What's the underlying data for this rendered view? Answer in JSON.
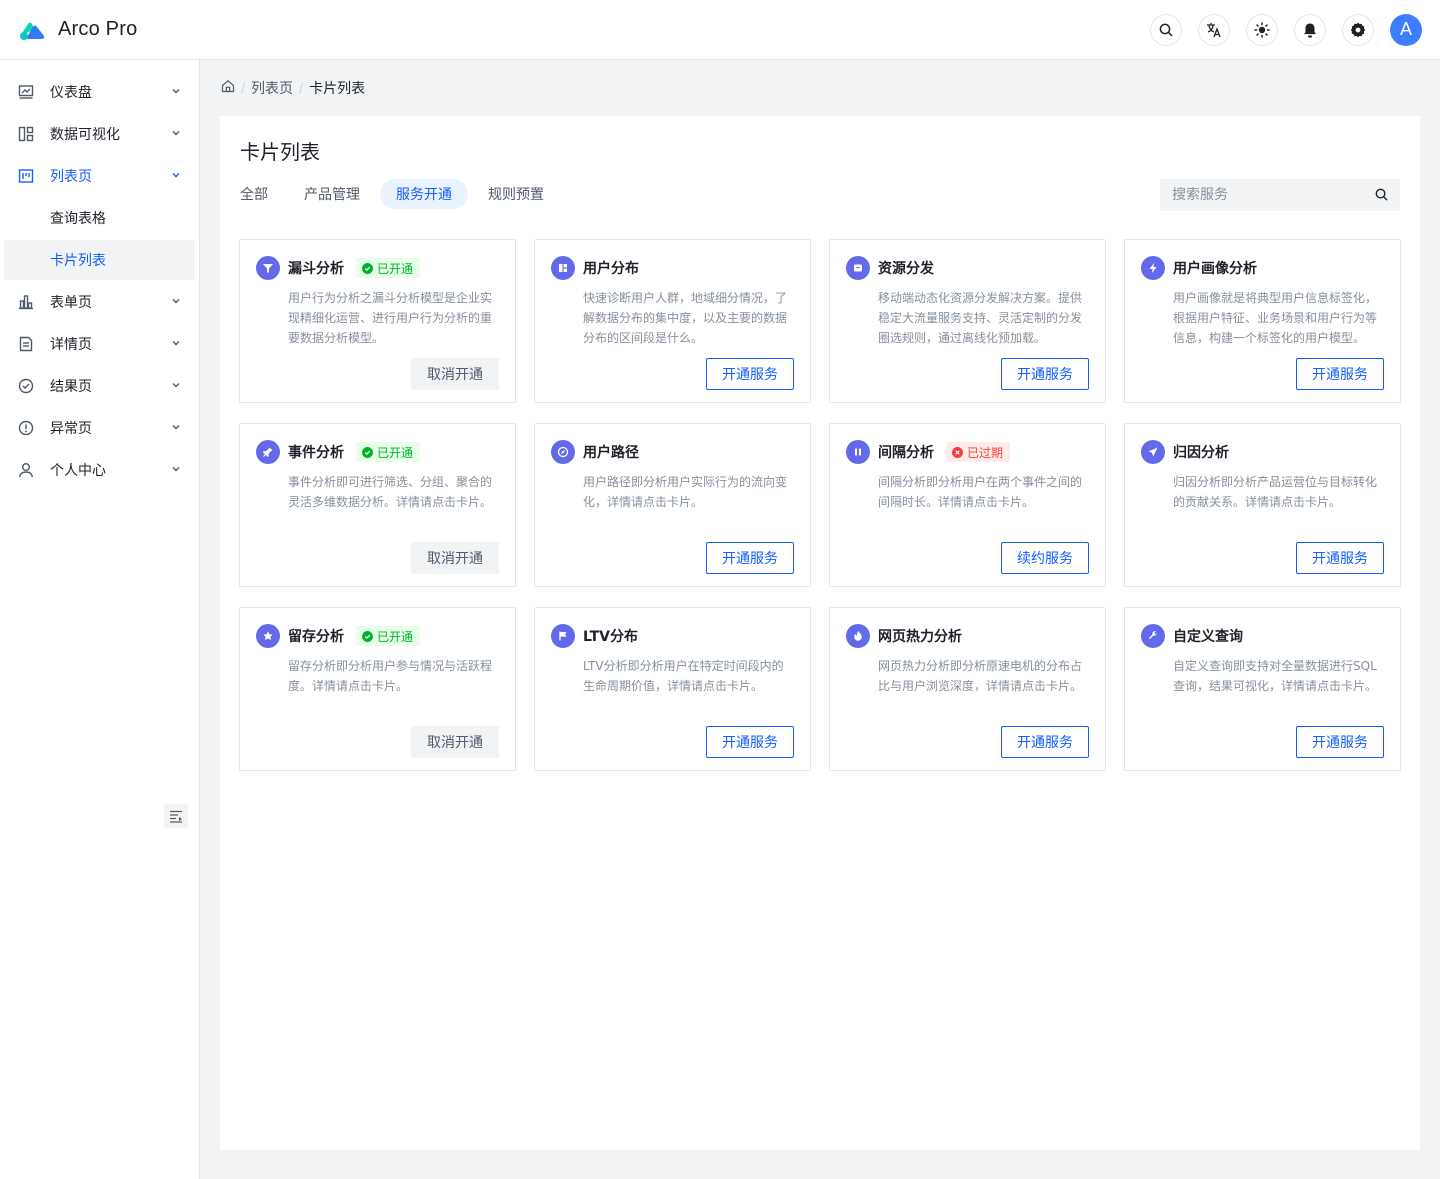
{
  "app": {
    "name": "Arco Pro"
  },
  "header": {
    "icons": [
      "search-icon",
      "translate-icon",
      "sun-icon",
      "bell-icon",
      "gear-icon"
    ],
    "avatar_initial": "A",
    "avatar_color": "#3c7eff"
  },
  "sidebar": {
    "items": [
      {
        "label": "仪表盘",
        "icon": "dashboard-icon"
      },
      {
        "label": "数据可视化",
        "icon": "layout-icon"
      },
      {
        "label": "列表页",
        "icon": "list-icon",
        "open": true,
        "children": [
          {
            "label": "查询表格"
          },
          {
            "label": "卡片列表",
            "active": true
          }
        ]
      },
      {
        "label": "表单页",
        "icon": "bar-chart-icon"
      },
      {
        "label": "详情页",
        "icon": "document-icon"
      },
      {
        "label": "结果页",
        "icon": "check-circle-icon"
      },
      {
        "label": "异常页",
        "icon": "exclamation-circle-icon"
      },
      {
        "label": "个人中心",
        "icon": "user-icon"
      }
    ]
  },
  "breadcrumb": {
    "items": [
      "列表页",
      "卡片列表"
    ]
  },
  "page": {
    "title": "卡片列表",
    "tabs": [
      {
        "label": "全部"
      },
      {
        "label": "产品管理"
      },
      {
        "label": "服务开通",
        "active": true
      },
      {
        "label": "规则预置"
      }
    ],
    "search_placeholder": "搜索服务"
  },
  "colors": {
    "primary": "#165dff",
    "success": "#00b42a",
    "danger": "#f53f3f",
    "card_icon": "#626aea"
  },
  "cards": [
    {
      "title": "漏斗分析",
      "icon": "funnel-icon",
      "tag": "已开通",
      "tag_type": "ok",
      "desc": "用户行为分析之漏斗分析模型是企业实现精细化运营、进行用户行为分析的重要数据分析模型。",
      "button": "取消开通",
      "button_type": "secondary"
    },
    {
      "title": "用户分布",
      "icon": "apps-icon",
      "tag": "",
      "tag_type": "",
      "desc": "快速诊断用户人群，地域细分情况，了解数据分布的集中度，以及主要的数据分布的区间段是什么。",
      "button": "开通服务",
      "button_type": "primary"
    },
    {
      "title": "资源分发",
      "icon": "archive-icon",
      "tag": "",
      "tag_type": "",
      "desc": "移动端动态化资源分发解决方案。提供稳定大流量服务支持、灵活定制的分发圈选规则，通过离线化预加载。",
      "button": "开通服务",
      "button_type": "primary"
    },
    {
      "title": "用户画像分析",
      "icon": "thunder-icon",
      "tag": "",
      "tag_type": "",
      "desc": "用户画像就是将典型用户信息标签化，根据用户特征、业务场景和用户行为等信息，构建一个标签化的用户模型。",
      "button": "开通服务",
      "button_type": "primary"
    },
    {
      "title": "事件分析",
      "icon": "pushpin-icon",
      "tag": "已开通",
      "tag_type": "ok",
      "desc": "事件分析即可进行筛选、分组、聚合的灵活多维数据分析。详情请点击卡片。",
      "button": "取消开通",
      "button_type": "secondary"
    },
    {
      "title": "用户路径",
      "icon": "compass-icon",
      "tag": "",
      "tag_type": "",
      "desc": "用户路径即分析用户实际行为的流向变化，详情请点击卡片。",
      "button": "开通服务",
      "button_type": "primary"
    },
    {
      "title": "间隔分析",
      "icon": "pause-icon",
      "tag": "已过期",
      "tag_type": "exp",
      "desc": "间隔分析即分析用户在两个事件之间的间隔时长。详情请点击卡片。",
      "button": "续约服务",
      "button_type": "primary"
    },
    {
      "title": "归因分析",
      "icon": "send-icon",
      "tag": "",
      "tag_type": "",
      "desc": "归因分析即分析产品运营位与目标转化的贡献关系。详情请点击卡片。",
      "button": "开通服务",
      "button_type": "primary"
    },
    {
      "title": "留存分析",
      "icon": "star-icon",
      "tag": "已开通",
      "tag_type": "ok",
      "desc": "留存分析即分析用户参与情况与活跃程度。详情请点击卡片。",
      "button": "取消开通",
      "button_type": "secondary"
    },
    {
      "title": "LTV分布",
      "icon": "flag-icon",
      "tag": "",
      "tag_type": "",
      "desc": "LTV分析即分析用户在特定时间段内的生命周期价值，详情请点击卡片。",
      "button": "开通服务",
      "button_type": "primary"
    },
    {
      "title": "网页热力分析",
      "icon": "fire-icon",
      "tag": "",
      "tag_type": "",
      "desc": "网页热力分析即分析原速电机的分布占比与用户浏览深度，详情请点击卡片。",
      "button": "开通服务",
      "button_type": "primary"
    },
    {
      "title": "自定义查询",
      "icon": "tool-icon",
      "tag": "",
      "tag_type": "",
      "desc": "自定义查询即支持对全量数据进行SQL查询，结果可视化，详情请点击卡片。",
      "button": "开通服务",
      "button_type": "primary"
    }
  ]
}
